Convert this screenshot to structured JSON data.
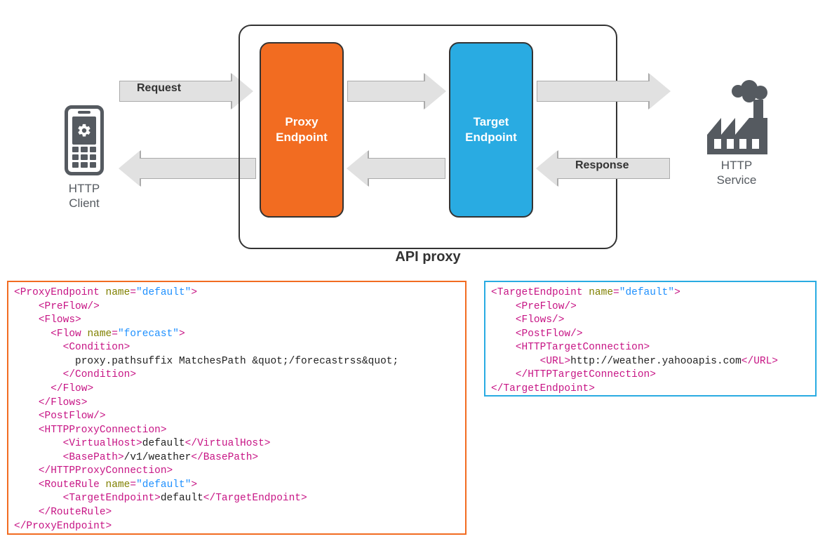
{
  "diagram": {
    "request_label": "Request",
    "response_label": "Response",
    "proxy_box": "Proxy\nEndpoint",
    "target_box": "Target\nEndpoint",
    "api_label": "API proxy",
    "client_label": "HTTP\nClient",
    "service_label": "HTTP\nService"
  },
  "xml": {
    "proxy_endpoint": {
      "element": "ProxyEndpoint",
      "name_attr": "default",
      "preflow": "PreFlow",
      "flows": "Flows",
      "flow_element": "Flow",
      "flow_name_attr": "forecast",
      "condition_element": "Condition",
      "condition_text": "proxy.pathsuffix MatchesPath &quot;/forecastrss&quot;",
      "postflow": "PostFlow",
      "http_proxy_conn": "HTTPProxyConnection",
      "virtualhost_element": "VirtualHost",
      "virtualhost_value": "default",
      "basepath_element": "BasePath",
      "basepath_value": "/v1/weather",
      "routerule_element": "RouteRule",
      "routerule_name_attr": "default",
      "targetendpoint_element": "TargetEndpoint",
      "targetendpoint_value": "default"
    },
    "target_endpoint": {
      "element": "TargetEndpoint",
      "name_attr": "default",
      "preflow": "PreFlow",
      "flows": "Flows",
      "postflow": "PostFlow",
      "http_target_conn": "HTTPTargetConnection",
      "url_element": "URL",
      "url_value": "http://weather.yahooapis.com"
    },
    "attr_name": "name"
  },
  "colors": {
    "proxy": "#f26c21",
    "target": "#29abe2",
    "icon": "#555a60",
    "arrow_fill": "#e1e1e1",
    "arrow_stroke": "#aaaaaa"
  }
}
